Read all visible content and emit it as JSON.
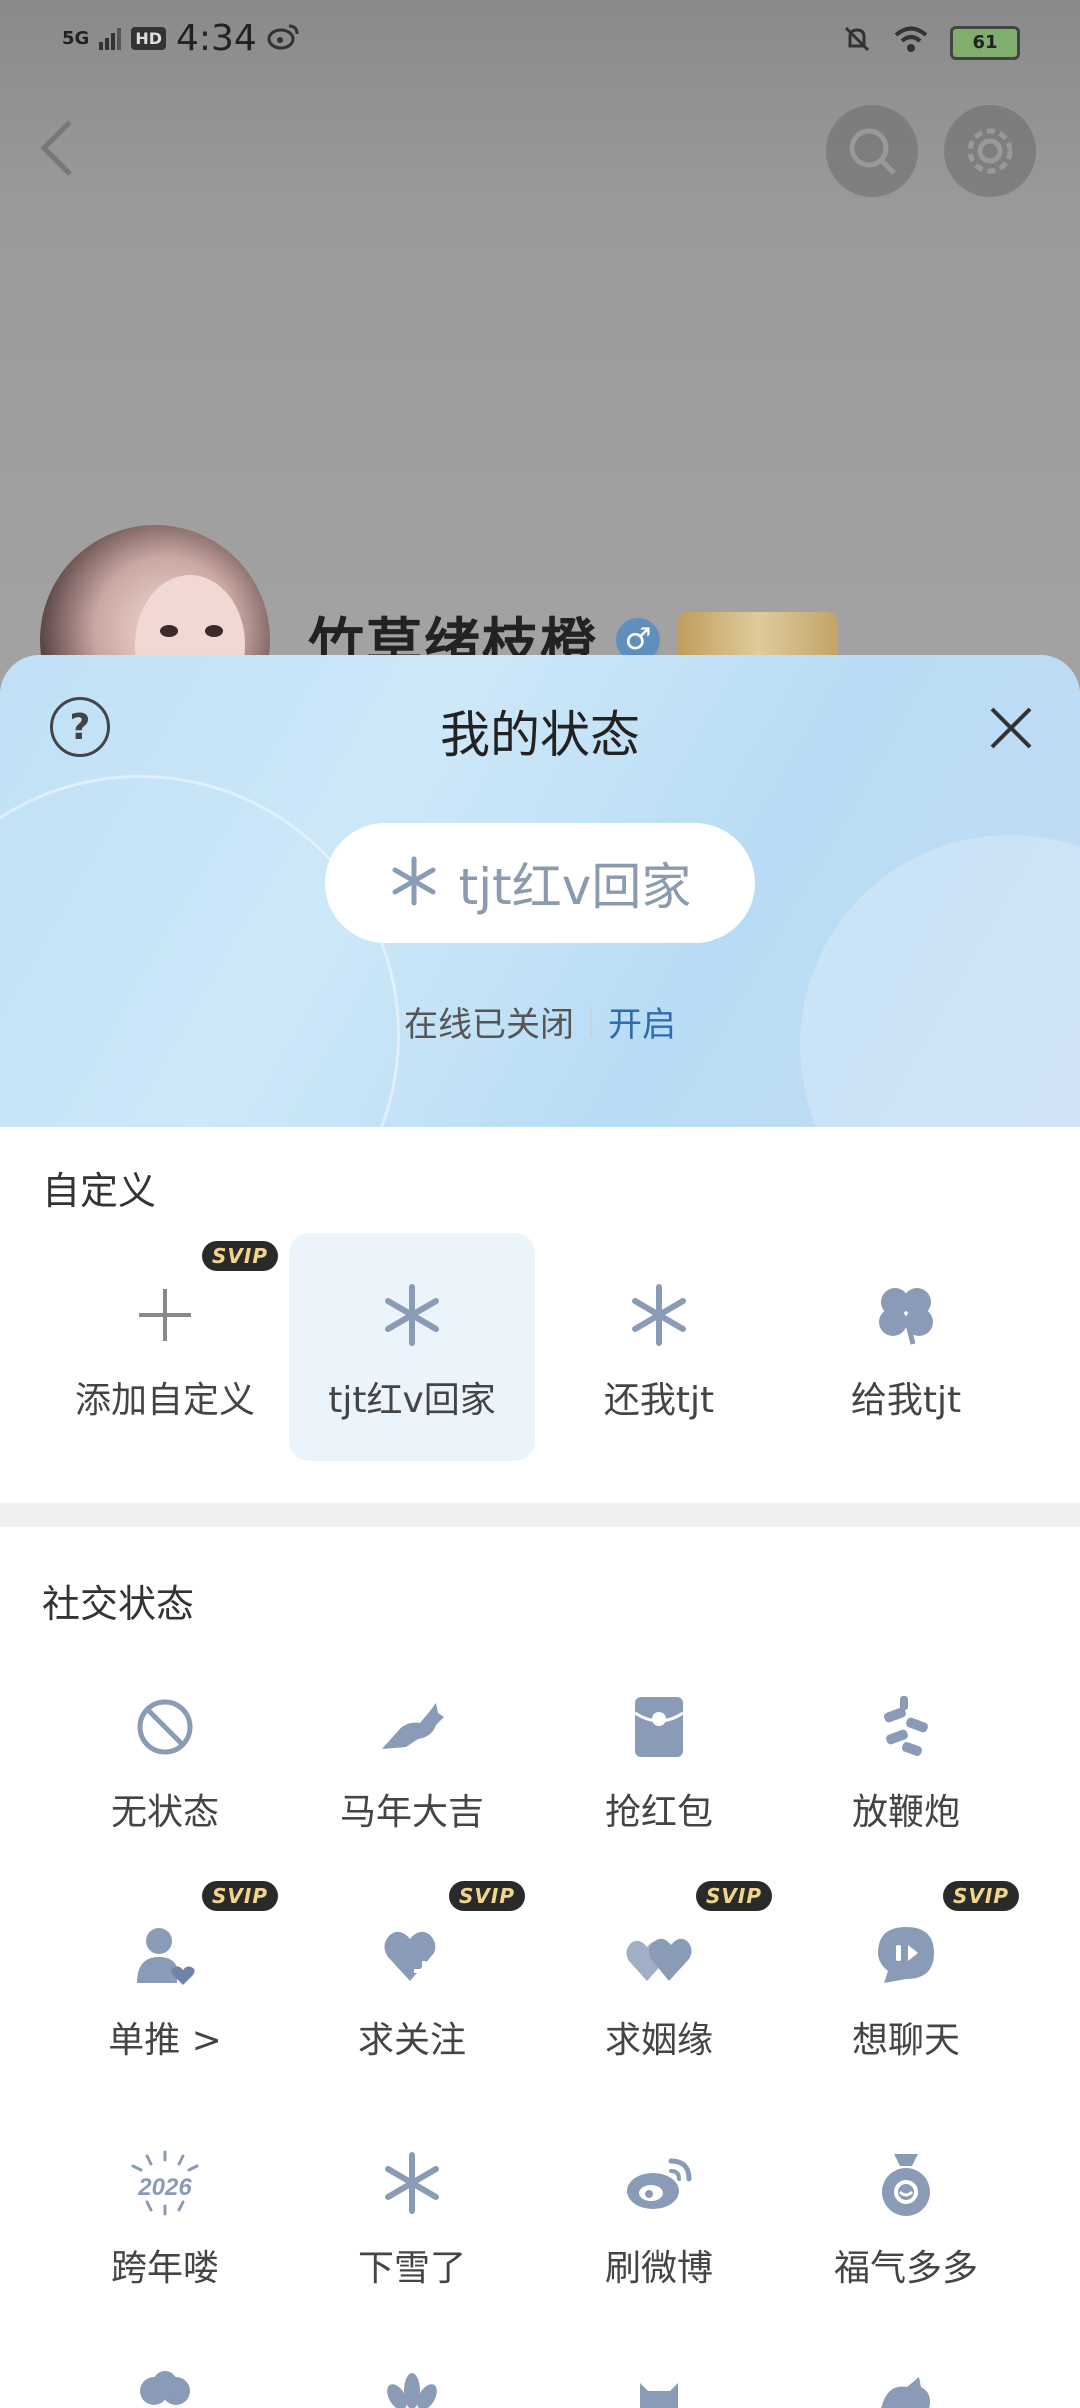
{
  "status_bar": {
    "network": "5G",
    "hd": "HD",
    "time": "4:34",
    "battery": "61"
  },
  "profile": {
    "username": "竹草绪枝橙",
    "gender_symbol": "♂"
  },
  "sheet": {
    "title": "我的状态",
    "current_status": "tjt红v回家",
    "online_text": "在线已关闭",
    "online_action": "开启"
  },
  "custom": {
    "title": "自定义",
    "items": [
      {
        "label": "添加自定义",
        "icon": "plus-icon",
        "svip": "SVIP"
      },
      {
        "label": "tjt红v回家",
        "icon": "snowflake-icon",
        "selected": true
      },
      {
        "label": "还我tjt",
        "icon": "snowflake-icon"
      },
      {
        "label": "给我tjt",
        "icon": "clover-icon"
      }
    ]
  },
  "social": {
    "title": "社交状态",
    "items": [
      {
        "label": "无状态",
        "icon": "no-status-icon"
      },
      {
        "label": "马年大吉",
        "icon": "horse-icon"
      },
      {
        "label": "抢红包",
        "icon": "red-envelope-icon"
      },
      {
        "label": "放鞭炮",
        "icon": "firecracker-icon"
      },
      {
        "label": "单推 >",
        "icon": "person-heart-icon",
        "svip": "SVIP"
      },
      {
        "label": "求关注",
        "icon": "heart-plus-icon",
        "svip": "SVIP"
      },
      {
        "label": "求姻缘",
        "icon": "hearts-icon",
        "svip": "SVIP"
      },
      {
        "label": "想聊天",
        "icon": "chat-icon",
        "svip": "SVIP"
      },
      {
        "label": "跨年喽",
        "icon": "year-2026-icon",
        "year": "2026"
      },
      {
        "label": "下雪了",
        "icon": "snowflake-icon"
      },
      {
        "label": "刷微博",
        "icon": "weibo-icon"
      },
      {
        "label": "福气多多",
        "icon": "fortune-bag-icon"
      }
    ]
  },
  "colors": {
    "icon": "#8a9bb8",
    "accent": "#2f6cae",
    "svip_text": "#f0d58a"
  }
}
